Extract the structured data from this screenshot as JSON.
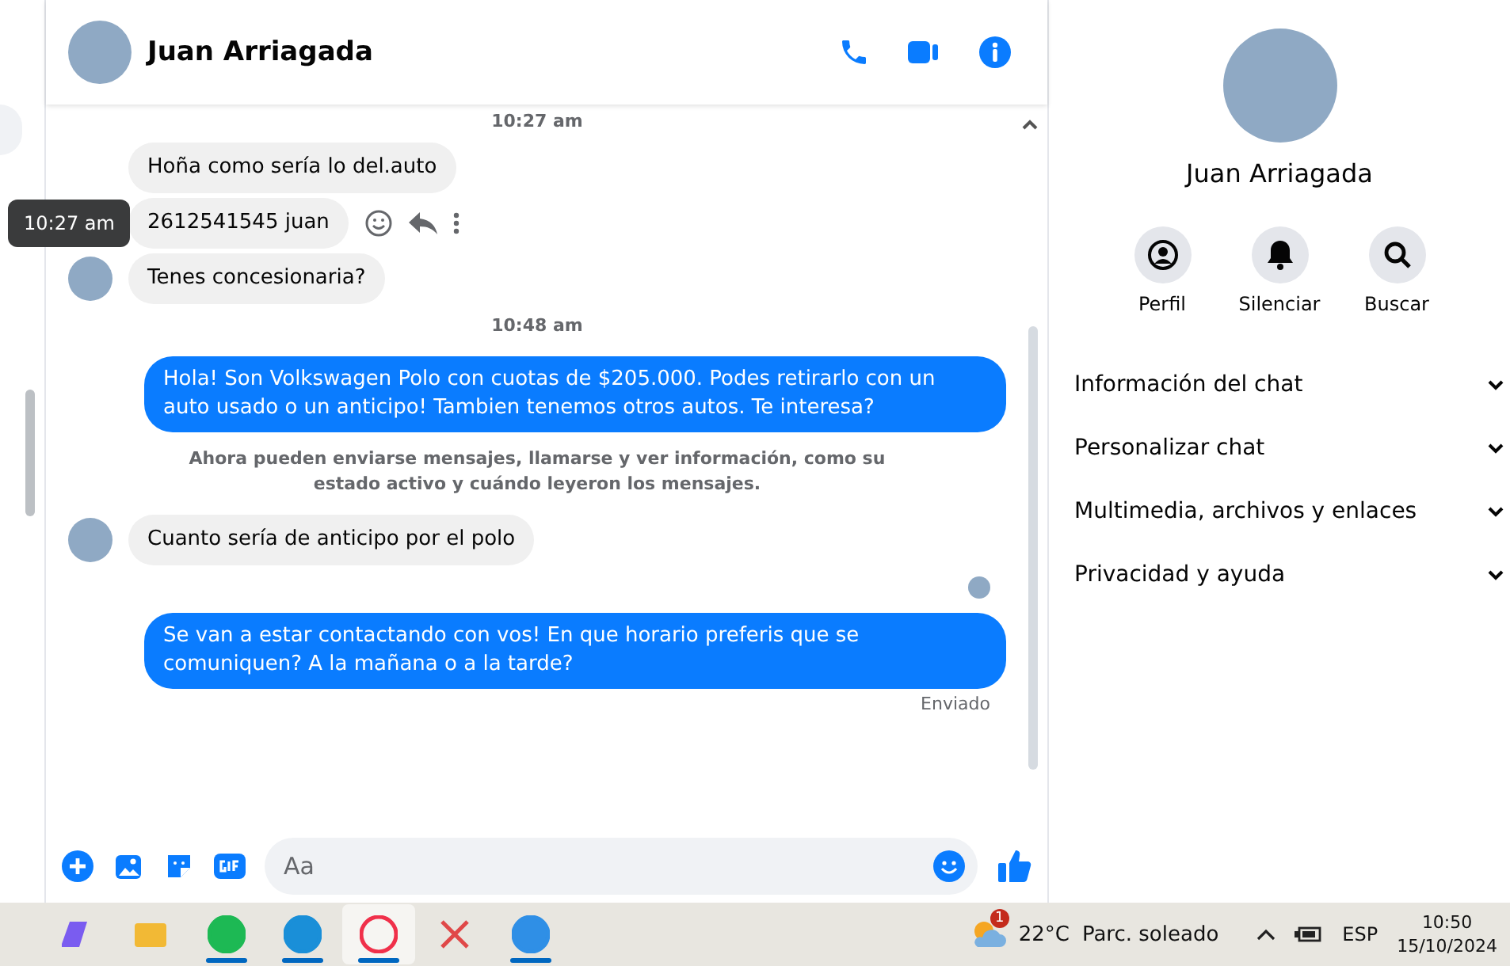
{
  "header": {
    "name": "Juan Arriagada"
  },
  "messages": [
    {
      "kind": "timestamp",
      "text": "10:27 am"
    },
    {
      "kind": "incoming",
      "text": "Hoña como sería lo del.auto",
      "avatar": false,
      "hovered": false
    },
    {
      "kind": "incoming",
      "text": "2612541545 juan",
      "avatar": false,
      "hovered": true,
      "tooltip": "10:27 am"
    },
    {
      "kind": "incoming",
      "text": "Tenes concesionaria?",
      "avatar": true,
      "hovered": false
    },
    {
      "kind": "timestamp",
      "text": "10:48 am"
    },
    {
      "kind": "outgoing",
      "text": "Hola! Son Volkswagen Polo con cuotas de $205.000. Podes retirarlo con un auto usado o un anticipo! Tambien tenemos otros autos. Te interesa?"
    },
    {
      "kind": "notice",
      "text": "Ahora pueden enviarse mensajes, llamarse y ver información, como su estado activo y cuándo leyeron los mensajes."
    },
    {
      "kind": "incoming",
      "text": "Cuanto sería de anticipo por el polo",
      "avatar": true,
      "hovered": false
    },
    {
      "kind": "seen"
    },
    {
      "kind": "outgoing",
      "text": "Se van a estar contactando con vos! En que horario preferis que se comuniquen? A la mañana o a la tarde?"
    },
    {
      "kind": "status",
      "text": "Enviado"
    }
  ],
  "composer": {
    "placeholder": "Aa"
  },
  "profile": {
    "name": "Juan Arriagada",
    "actions": [
      {
        "kind": "profile",
        "label": "Perfil"
      },
      {
        "kind": "mute",
        "label": "Silenciar"
      },
      {
        "kind": "search",
        "label": "Buscar"
      }
    ],
    "sections": [
      "Información del chat",
      "Personalizar chat",
      "Multimedia, archivos y enlaces",
      "Privacidad y ayuda"
    ]
  },
  "taskbar": {
    "apps": [
      {
        "kind": "copilot",
        "running": false,
        "selected": false
      },
      {
        "kind": "folder",
        "running": false,
        "selected": false
      },
      {
        "kind": "music",
        "running": true,
        "selected": false
      },
      {
        "kind": "browser",
        "running": true,
        "selected": false
      },
      {
        "kind": "ring",
        "running": true,
        "selected": true
      },
      {
        "kind": "scissors",
        "running": false,
        "selected": false
      },
      {
        "kind": "chrome",
        "running": true,
        "selected": false
      }
    ],
    "weather": {
      "badge": "1",
      "temperature": "22°C",
      "condition": "Parc. soleado"
    },
    "language": "ESP",
    "time": "10:50",
    "date": "15/10/2024"
  }
}
